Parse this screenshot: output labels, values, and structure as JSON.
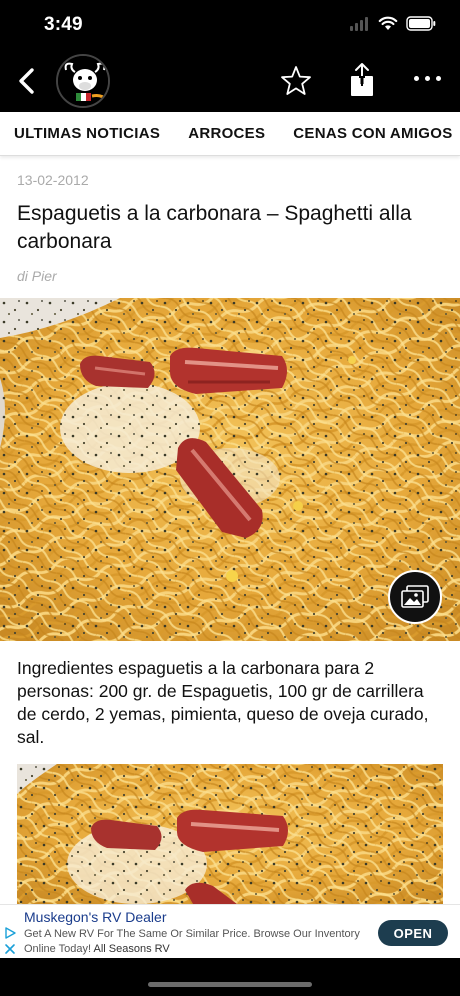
{
  "status_bar": {
    "time": "3:49"
  },
  "nav": {
    "back_icon": "chevron-left-icon",
    "logo_icon": "bull-logo",
    "actions": [
      "star-icon",
      "share-icon",
      "more-icon"
    ]
  },
  "tabs": [
    {
      "label": "ULTIMAS NOTICIAS"
    },
    {
      "label": "ARROCES"
    },
    {
      "label": "CENAS CON AMIGOS"
    }
  ],
  "article": {
    "date": "13-02-2012",
    "title": "Espaguetis a la carbonara – Spaghetti alla carbonara",
    "author": "di Pier",
    "body": "Ingredientes espaguetis a la carbonara para 2 personas: 200 gr. de Espaguetis, 100 gr de carrillera de cerdo, 2 yemas, pimienta, queso de oveja curado, sal."
  },
  "ad": {
    "title": "Muskegon's RV Dealer",
    "description": "Get A New RV For The Same Or Similar Price. Browse Our Inventory Online Today!",
    "advertiser": "All Seasons RV",
    "cta": "OPEN"
  },
  "colors": {
    "header_bg": "#000000",
    "ad_title": "#1a3c8c",
    "ad_button": "#1d3d4f",
    "muted_text": "#aaaaaa"
  }
}
